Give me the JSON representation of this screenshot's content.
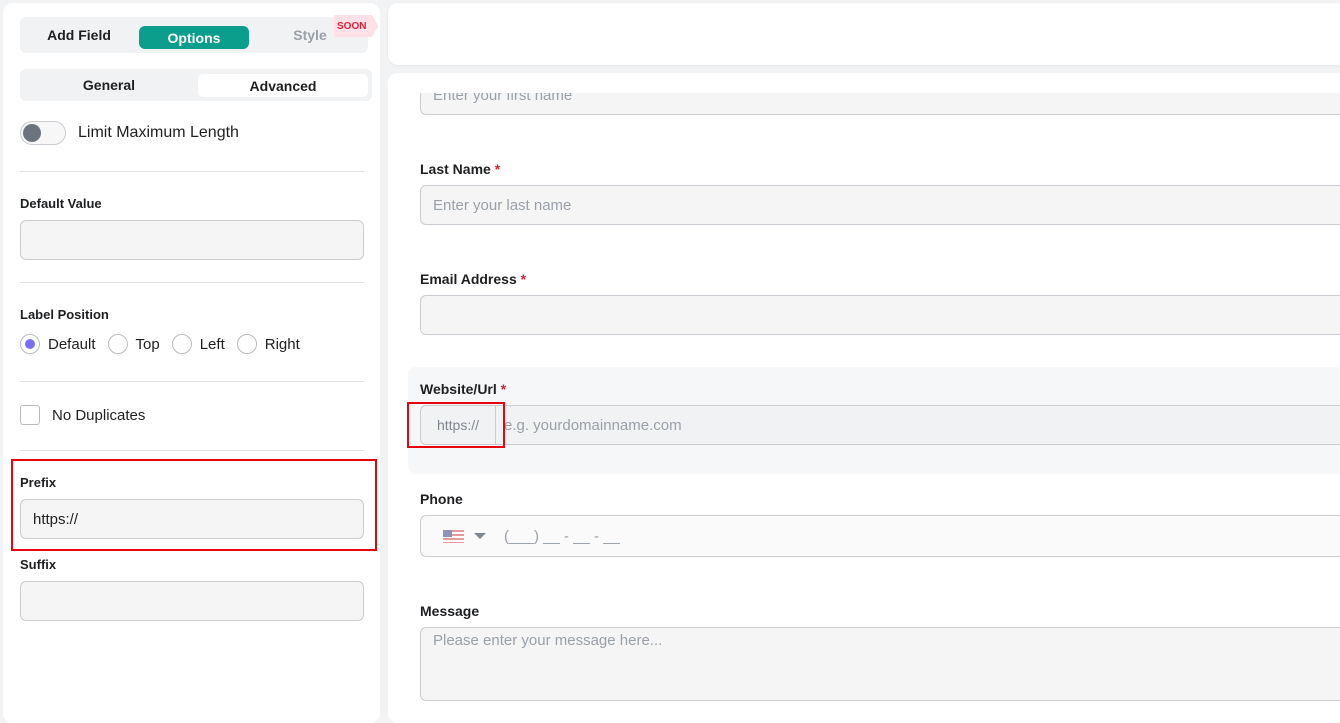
{
  "left_panel": {
    "tabs": {
      "add_field": "Add Field",
      "options": "Options",
      "style": "Style",
      "soon_badge": "SOON"
    },
    "subtabs": {
      "general": "General",
      "advanced": "Advanced"
    },
    "limit_max_length": {
      "label": "Limit Maximum Length",
      "enabled": false
    },
    "default_value": {
      "label": "Default Value",
      "value": ""
    },
    "label_position": {
      "label": "Label Position",
      "options": [
        "Default",
        "Top",
        "Left",
        "Right"
      ],
      "selected": "Default"
    },
    "no_duplicates": {
      "label": "No Duplicates",
      "checked": false
    },
    "prefix": {
      "label": "Prefix",
      "value": "https://"
    },
    "suffix": {
      "label": "Suffix",
      "value": ""
    }
  },
  "form": {
    "first_name": {
      "placeholder": "Enter your first name"
    },
    "last_name": {
      "label": "Last Name",
      "required": "*",
      "placeholder": "Enter your last name"
    },
    "email": {
      "label": "Email Address",
      "required": "*",
      "placeholder": ""
    },
    "website": {
      "label": "Website/Url",
      "required": "*",
      "prefix": "https://",
      "placeholder": "e.g. yourdomainname.com"
    },
    "phone": {
      "label": "Phone",
      "placeholder": "(___) __ - __ - __"
    },
    "message": {
      "label": "Message",
      "placeholder": "Please enter your message here..."
    }
  },
  "colors": {
    "accent": "#0b9e8c",
    "radio": "#7b6ef6",
    "highlight": "#e5050f"
  }
}
